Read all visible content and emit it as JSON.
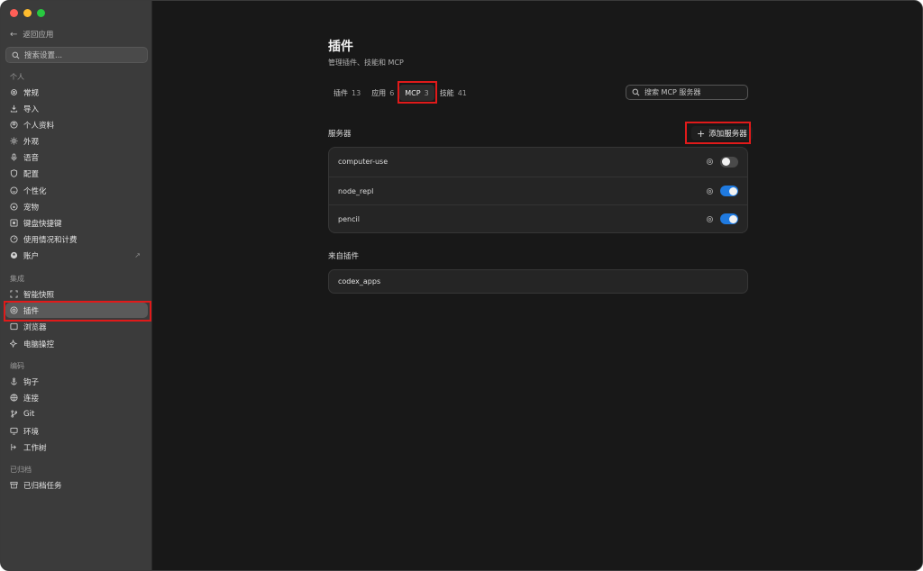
{
  "window": {
    "controls": [
      "close",
      "minimize",
      "zoom"
    ]
  },
  "sidebar": {
    "back_label": "返回应用",
    "search_placeholder": "搜索设置...",
    "sections": [
      {
        "title": "个人",
        "items": [
          {
            "label": "常规",
            "icon": "gear-icon"
          },
          {
            "label": "导入",
            "icon": "download-icon"
          },
          {
            "label": "个人资料",
            "icon": "user-circle-icon"
          },
          {
            "label": "外观",
            "icon": "sun-icon"
          },
          {
            "label": "语音",
            "icon": "microphone-icon"
          },
          {
            "label": "配置",
            "icon": "shield-icon"
          },
          {
            "label": "个性化",
            "icon": "smile-icon"
          },
          {
            "label": "宠物",
            "icon": "paw-icon"
          },
          {
            "label": "键盘快捷键",
            "icon": "keyboard-icon"
          },
          {
            "label": "使用情况和计费",
            "icon": "gauge-icon"
          },
          {
            "label": "账户",
            "icon": "account-icon",
            "external": "↗"
          }
        ]
      },
      {
        "title": "集成",
        "items": [
          {
            "label": "智能快照",
            "icon": "scan-icon"
          },
          {
            "label": "插件",
            "icon": "plugin-icon",
            "active": true
          },
          {
            "label": "浏览器",
            "icon": "browser-icon"
          },
          {
            "label": "电脑操控",
            "icon": "sparkle-icon"
          }
        ]
      },
      {
        "title": "编码",
        "items": [
          {
            "label": "钩子",
            "icon": "anchor-icon"
          },
          {
            "label": "连接",
            "icon": "globe-icon"
          },
          {
            "label": "Git",
            "icon": "git-branch-icon"
          },
          {
            "label": "环境",
            "icon": "monitor-icon"
          },
          {
            "label": "工作树",
            "icon": "worktree-icon"
          }
        ]
      },
      {
        "title": "已归档",
        "items": [
          {
            "label": "已归档任务",
            "icon": "archive-icon"
          }
        ]
      }
    ]
  },
  "main": {
    "title": "插件",
    "subtitle": "管理插件、技能和 MCP",
    "tabs": [
      {
        "label": "插件",
        "count": "13",
        "active": false
      },
      {
        "label": "应用",
        "count": "6",
        "active": false
      },
      {
        "label": "MCP",
        "count": "3",
        "active": true
      },
      {
        "label": "技能",
        "count": "41",
        "active": false
      }
    ],
    "search_placeholder": "搜索 MCP 服务器",
    "servers_label": "服务器",
    "add_server_label": "添加服务器",
    "servers": [
      {
        "name": "computer-use",
        "enabled": false
      },
      {
        "name": "node_repl",
        "enabled": true
      },
      {
        "name": "pencil",
        "enabled": true
      }
    ],
    "from_plugins_label": "来自插件",
    "plugin_servers": [
      {
        "name": "codex_apps"
      }
    ]
  },
  "colors": {
    "accent": "#1f7ae0",
    "highlight": "#e01a1a",
    "sidebar_bg": "#3b3b3b",
    "main_bg": "#181818"
  }
}
